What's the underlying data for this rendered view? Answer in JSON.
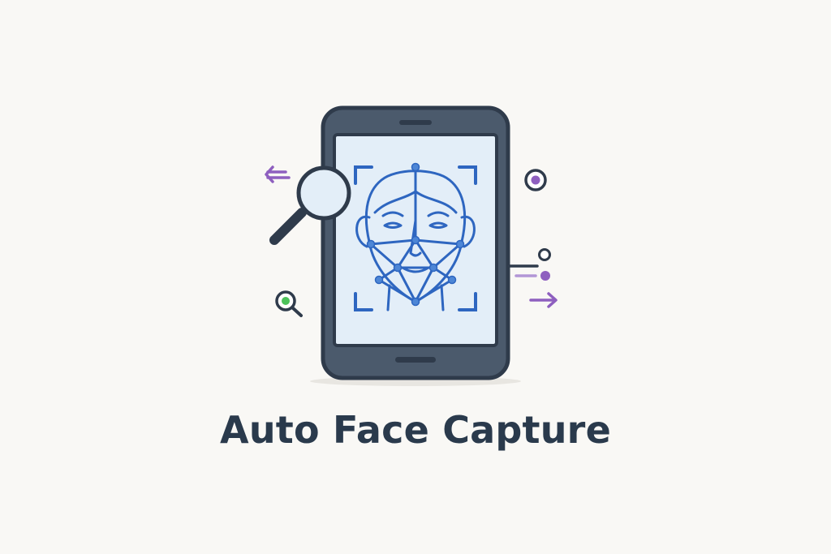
{
  "title": "Auto Face Capture",
  "icons": {
    "phone": "smartphone-icon",
    "face": "face-mesh-icon",
    "frame": "scan-frame-icon",
    "magnifier": "magnifying-glass-icon",
    "small_magnifier": "search-icon",
    "target": "target-icon",
    "arrow_left": "arrow-left-icon",
    "arrow_right": "arrow-right-icon",
    "connector": "connector-dots-icon"
  },
  "colors": {
    "background": "#f9f8f5",
    "phone_body": "#4b5a6c",
    "phone_outline": "#2f3b4b",
    "screen": "#e3eef8",
    "face_stroke": "#2e66c0",
    "accent_purple": "#8e5fbf",
    "accent_green": "#4cc25a",
    "title_text": "#2a3a4c"
  }
}
